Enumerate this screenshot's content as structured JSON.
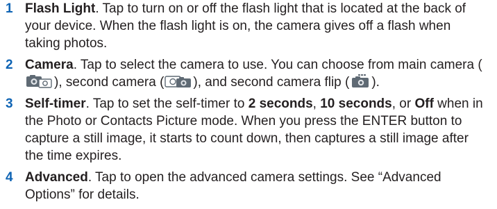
{
  "items": [
    {
      "number": "1",
      "term": "Flash Light",
      "text": ". Tap to turn on or off the flash light that is located at the back of your device. When the flash light is on, the camera gives off a flash when taking photos."
    },
    {
      "number": "2",
      "term": "Camera",
      "text_a": ". Tap to select the camera to use. You can choose from main camera (",
      "text_b": "), second camera (",
      "text_c": "), and second camera flip (",
      "text_d": ").",
      "icons": [
        "main-camera-icon",
        "second-camera-icon",
        "second-camera-flip-icon"
      ]
    },
    {
      "number": "3",
      "term": "Self-timer",
      "text_a": ". Tap to set the self-timer to ",
      "opt1": "2 seconds",
      "sep1": ", ",
      "opt2": "10 seconds",
      "sep2": ", or ",
      "opt3": "Off",
      "text_b": " when in the Photo or Contacts Picture mode. When you press the ENTER button to capture a still image, it starts to count down, then captures a still image after the time expires."
    },
    {
      "number": "4",
      "term": "Advanced",
      "text": ". Tap to open the advanced camera settings. See “Advanced Options” for details."
    }
  ],
  "colors": {
    "number": "#0f64b4",
    "text": "#231f20"
  }
}
